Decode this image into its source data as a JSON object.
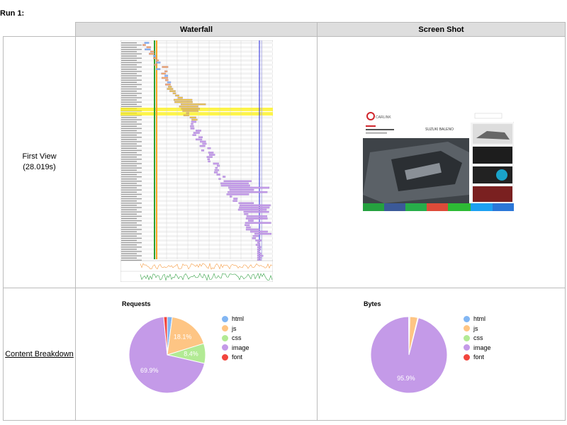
{
  "run_title": "Run 1:",
  "headers": {
    "waterfall": "Waterfall",
    "screenshot": "Screen Shot"
  },
  "first_view": {
    "label": "First View",
    "time": "(28.019s)"
  },
  "content_breakdown": {
    "label": "Content Breakdown"
  },
  "colors": {
    "html": "#82b6f3",
    "js": "#fec584",
    "css": "#b2ea94",
    "image": "#c49ae8",
    "font": "#f2453d"
  },
  "screenshot_site": {
    "logo": "CARLINK",
    "headline": "SUZUKI BALENO"
  },
  "chart_data": [
    {
      "type": "pie",
      "title": "Requests",
      "categories": [
        "html",
        "js",
        "css",
        "image",
        "font"
      ],
      "values": [
        2.1,
        18.1,
        8.4,
        69.9,
        1.5
      ],
      "labels": {
        "js": "18.1%",
        "css": "8.4%",
        "image": "69.9%"
      },
      "legend": "right"
    },
    {
      "type": "pie",
      "title": "Bytes",
      "categories": [
        "html",
        "js",
        "css",
        "image",
        "font"
      ],
      "values": [
        0.4,
        3.3,
        0.3,
        95.9,
        0.1
      ],
      "labels": {
        "image": "95.9%"
      },
      "legend": "right"
    }
  ]
}
